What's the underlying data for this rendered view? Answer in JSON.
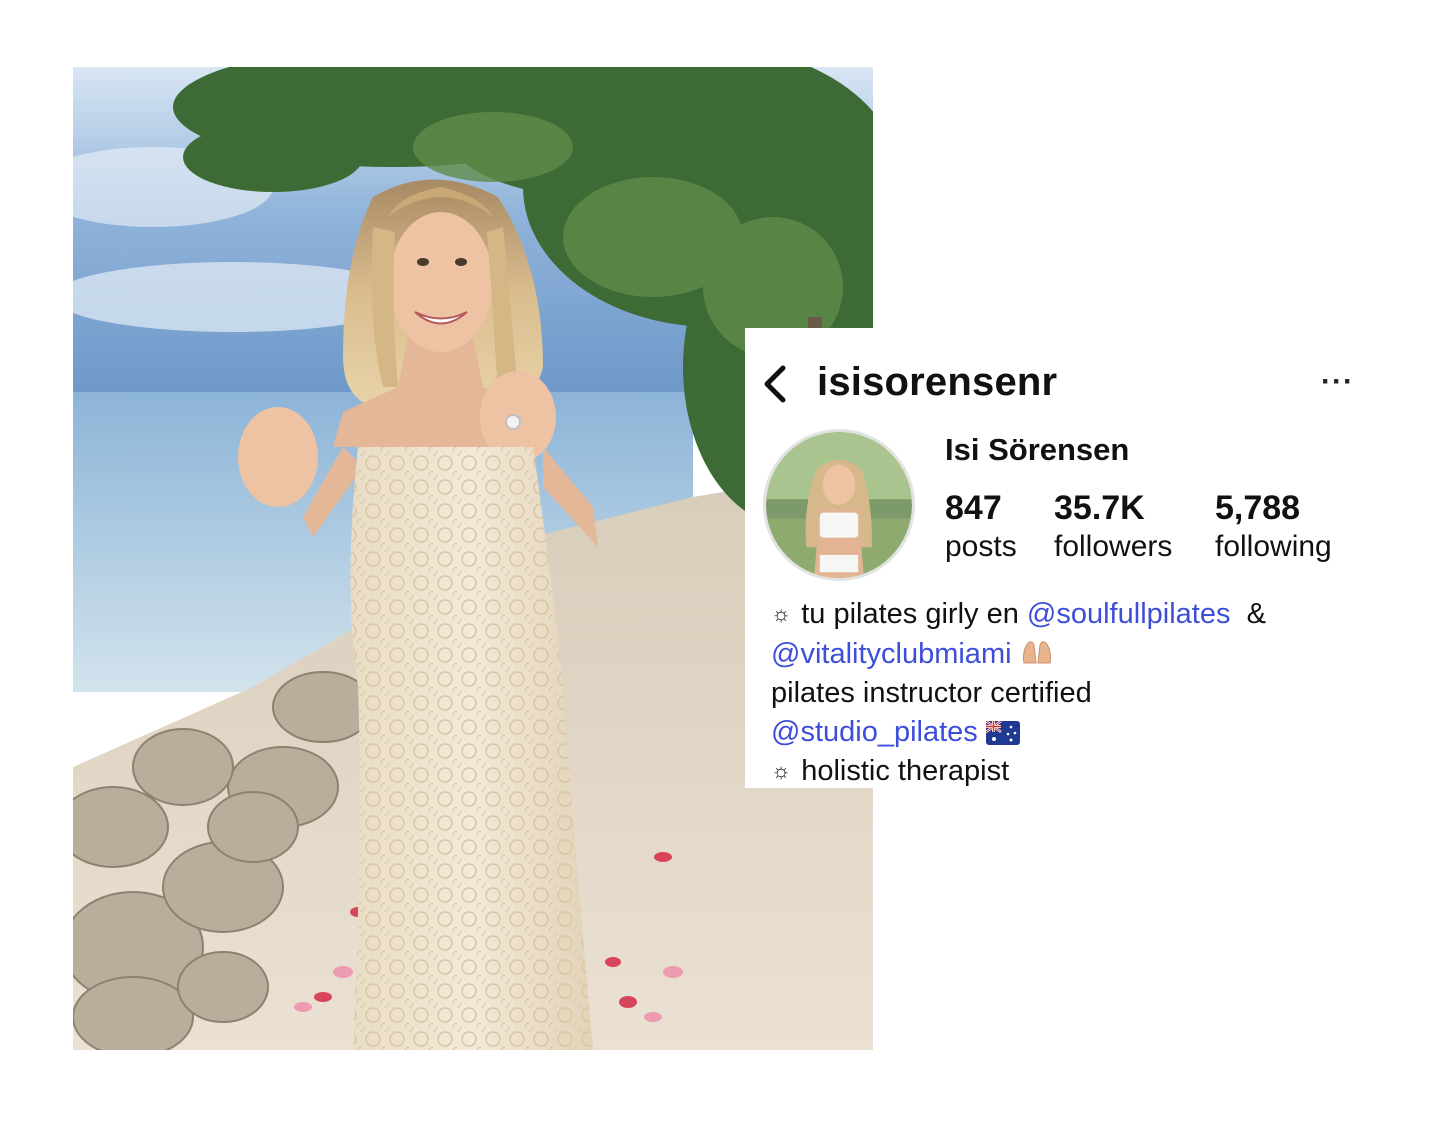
{
  "profile": {
    "username": "isisorensenr",
    "display_name": "Isi Sörensen",
    "stats": [
      {
        "value": "847",
        "label": "posts"
      },
      {
        "value": "35.7K",
        "label": "followers"
      },
      {
        "value": "5,788",
        "label": "following"
      }
    ],
    "bio": {
      "line1_text": "tu pilates girly en",
      "line1_mention": "@soulfullpilates",
      "line1_suffix": "&",
      "line2_mention": "@vitalityclubmiami",
      "line3_text": "pilates instructor certified",
      "line4_mention": "@studio_pilates",
      "line5_text": "holistic therapist"
    },
    "icons": {
      "back": "chevron-left-icon",
      "more": "more-options-icon",
      "bullet": "sun-icon",
      "line2_emoji": "hands-emoji",
      "line4_emoji": "australia-flag-emoji"
    }
  },
  "colors": {
    "mention": "#3d4ed8",
    "text": "#111111",
    "avatar_ring": "#e2e2e2"
  }
}
